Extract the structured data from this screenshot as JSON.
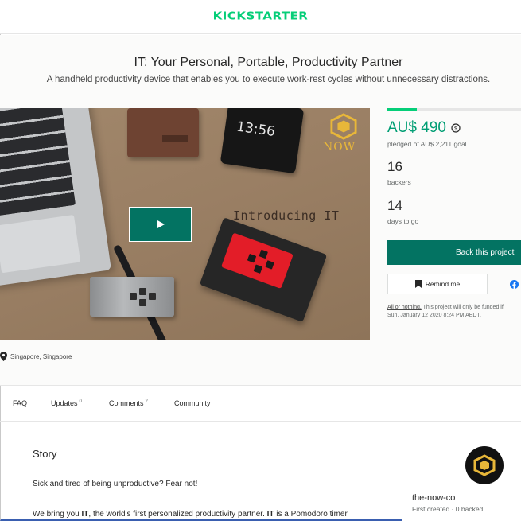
{
  "header": {
    "logo_text": "KICKSTARTER"
  },
  "project": {
    "title": "IT: Your Personal, Portable, Productivity Partner",
    "blurb": "A handheld productivity device that enables you to execute work-rest cycles without unnecessary distractions.",
    "location": "Singapore, Singapore"
  },
  "video": {
    "phone_time": "13:56",
    "brand_word": "NOW",
    "overlay_text": "Introducing IT",
    "play_icon": "play-icon"
  },
  "funding": {
    "progress_fraction": 0.22,
    "pledged": "AU$ 490",
    "pledged_label": "pledged of AU$ 2,211 goal",
    "backers": "16",
    "backers_label": "backers",
    "days": "14",
    "days_label": "days to go",
    "back_button": "Back this project",
    "remind_button": "Remind me",
    "fine_link": "All or nothing.",
    "fine_text": " This project will only be funded if",
    "fine_date": "Sun, January 12 2020 8:24 PM AEDT.",
    "accent_color": "#05ce78",
    "button_color": "#037362"
  },
  "tabs": [
    {
      "label": "FAQ",
      "count": ""
    },
    {
      "label": "Updates",
      "count": "0"
    },
    {
      "label": "Comments",
      "count": "2"
    },
    {
      "label": "Community",
      "count": ""
    }
  ],
  "story": {
    "heading": "Story",
    "para1": "Sick and tired of being unproductive? Fear not!",
    "para2_a": "We bring you ",
    "para2_b": "IT",
    "para2_c": ", the world's first personalized productivity partner. ",
    "para2_d": "IT",
    "para2_e": " is a Pomodoro timer"
  },
  "creator": {
    "name": "the-now-co",
    "meta": "First created · 0 backed"
  }
}
